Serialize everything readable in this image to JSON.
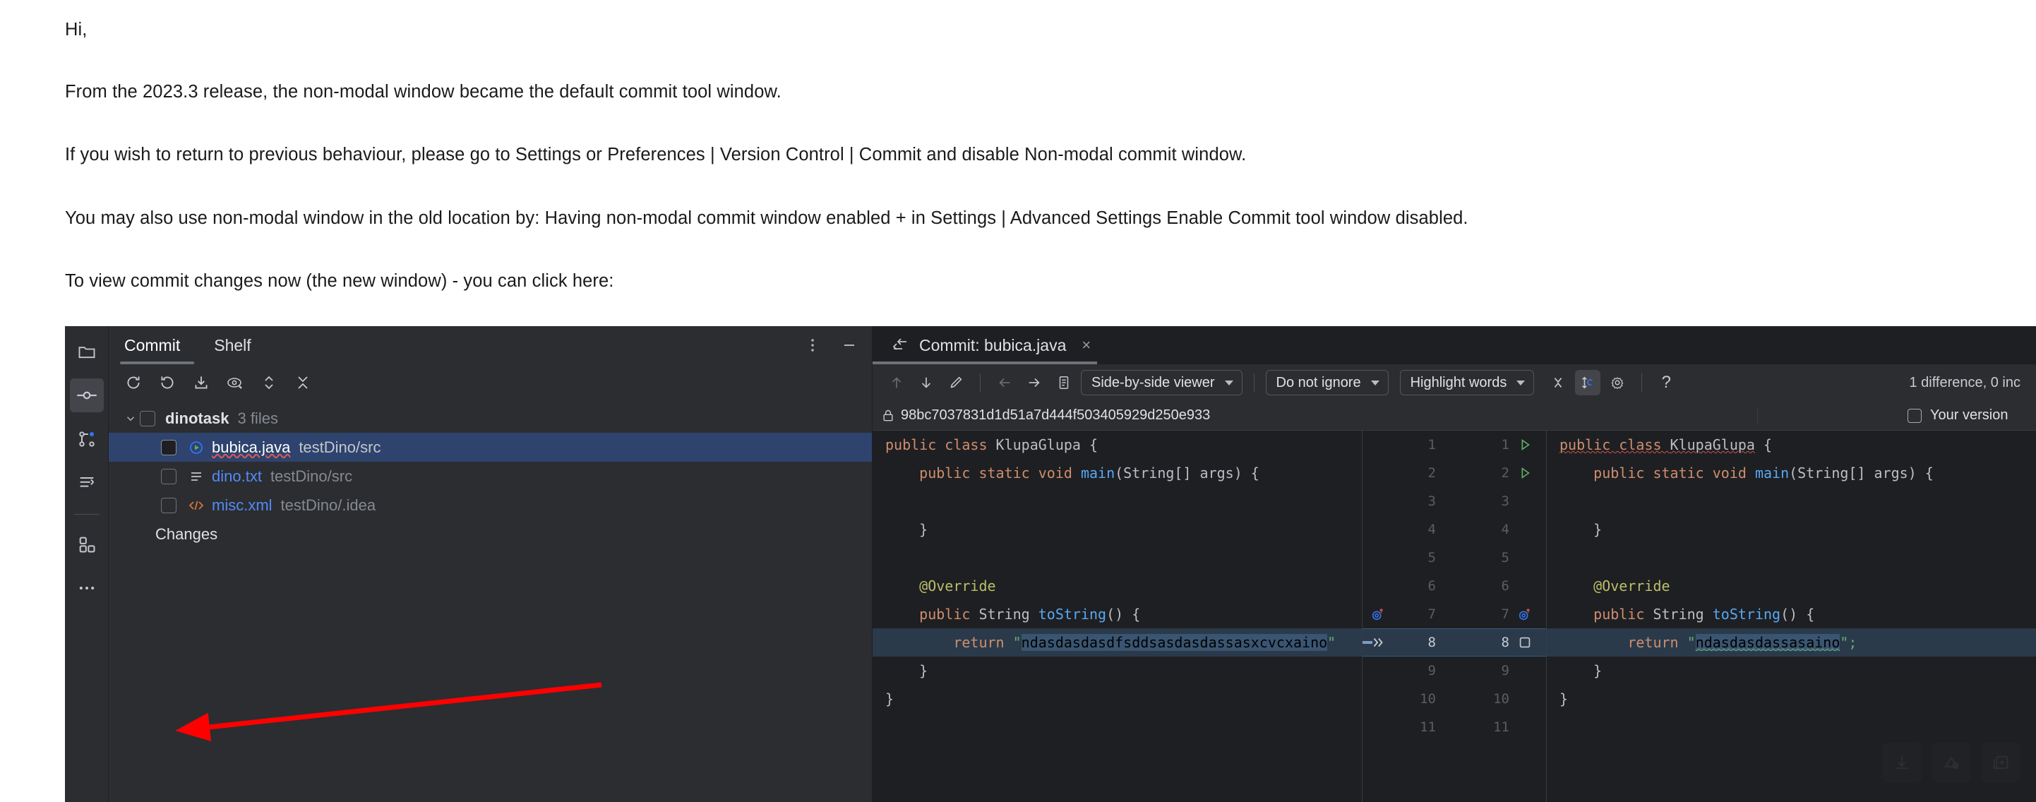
{
  "message": {
    "lines": [
      "Hi,",
      "From the 2023.3 release, the non-modal window became the default commit tool window.",
      "If you wish to return to previous behaviour, please go to Settings or Preferences | Version Control | Commit and disable Non-modal commit window.",
      "You may also use non-modal window in the old location by: Having non-modal commit window enabled + in Settings | Advanced Settings Enable Commit tool window disabled.",
      "To view commit changes now (the new window) - you can click here:"
    ]
  },
  "ide": {
    "activity_bar": {
      "items": [
        {
          "name": "project-icon",
          "label": "Project"
        },
        {
          "name": "commit-icon",
          "label": "Commit",
          "selected": true
        },
        {
          "name": "pull-requests-icon",
          "label": "Pull Requests"
        },
        {
          "name": "terminal-icon",
          "label": "Terminal"
        },
        {
          "name": "services-icon",
          "label": "Services"
        },
        {
          "name": "more-tool-windows-icon",
          "label": "More Tool Windows"
        }
      ]
    },
    "commit_window": {
      "tabs": [
        {
          "label": "Commit",
          "active": true
        },
        {
          "label": "Shelf",
          "active": false
        }
      ],
      "header_actions": [
        {
          "name": "options-menu-icon",
          "label": "Options"
        },
        {
          "name": "hide-icon",
          "label": "Hide"
        }
      ],
      "toolbar": [
        {
          "name": "refresh-icon",
          "label": "Refresh Changes"
        },
        {
          "name": "rollback-icon",
          "label": "Rollback"
        },
        {
          "name": "shelve-icon",
          "label": "Shelve Silently"
        },
        {
          "name": "preview-diff-icon",
          "label": "Preview Diff"
        },
        {
          "name": "expand-collapse-icon",
          "label": "Expand / Collapse"
        },
        {
          "name": "collapse-all-icon",
          "label": "Collapse All"
        }
      ],
      "tree": {
        "root": {
          "name": "dinotask",
          "count": "3 files",
          "expanded": true
        },
        "files": [
          {
            "name": "bubica.java",
            "path": "testDino/src",
            "icon": "java-run-icon",
            "selected": true,
            "checked": false
          },
          {
            "name": "dino.txt",
            "path": "testDino/src",
            "icon": "text-file-icon",
            "selected": false,
            "checked": false
          },
          {
            "name": "misc.xml",
            "path": "testDino/.idea",
            "icon": "xml-file-icon",
            "selected": false,
            "checked": false
          }
        ],
        "changes_label": "Changes"
      }
    },
    "diff": {
      "tab": {
        "title": "Commit: bubica.java",
        "icon": "diff-icon",
        "close": "×"
      },
      "toolbar": {
        "icons": [
          {
            "name": "previous-difference-icon",
            "glyph": "↑",
            "disabled": true
          },
          {
            "name": "next-difference-icon",
            "glyph": "↓",
            "disabled": false
          },
          {
            "name": "edit-source-icon",
            "glyph": "pencil",
            "disabled": false
          },
          {
            "name": "apply-left-icon",
            "glyph": "←",
            "disabled": true
          },
          {
            "name": "apply-right-icon",
            "glyph": "→",
            "disabled": false
          },
          {
            "name": "show-diff-in-editor-icon",
            "glyph": "doc",
            "disabled": false
          }
        ],
        "viewer_mode": "Side-by-side viewer",
        "ignore_mode": "Do not ignore",
        "highlight_mode": "Highlight words",
        "right_icons": [
          {
            "name": "collapse-unchanged-icon",
            "glyph": "×"
          },
          {
            "name": "synchronize-scrolling-icon",
            "glyph": "↕",
            "active": true
          },
          {
            "name": "diff-settings-icon",
            "glyph": "gear"
          },
          {
            "name": "help-icon",
            "glyph": "?"
          }
        ],
        "status": "1 difference, 0 inc"
      },
      "left_header": {
        "icon": "lock-icon",
        "revision": "98bc7037831d1d51a7d444f503405929d250e933"
      },
      "right_header": {
        "checkbox": true,
        "label": "Your version"
      },
      "left_lines": [
        {
          "num": 1,
          "tokens": [
            {
              "t": "public class ",
              "c": "kw"
            },
            {
              "t": "KlupaGlupa",
              "c": "id"
            },
            {
              "t": " {",
              "c": "punc"
            }
          ]
        },
        {
          "num": 2,
          "tokens": [
            {
              "t": "    public static void ",
              "c": "kw"
            },
            {
              "t": "main",
              "c": "fn"
            },
            {
              "t": "(String[] args) {",
              "c": "punc"
            }
          ]
        },
        {
          "num": 3,
          "tokens": [
            {
              "t": "",
              "c": "punc"
            }
          ]
        },
        {
          "num": 4,
          "tokens": [
            {
              "t": "    }",
              "c": "punc"
            }
          ]
        },
        {
          "num": 5,
          "tokens": [
            {
              "t": "",
              "c": "punc"
            }
          ]
        },
        {
          "num": 6,
          "tokens": [
            {
              "t": "    @Override",
              "c": "ann"
            }
          ]
        },
        {
          "num": 7,
          "tokens": [
            {
              "t": "    public ",
              "c": "kw"
            },
            {
              "t": "String ",
              "c": "id"
            },
            {
              "t": "toString",
              "c": "fn"
            },
            {
              "t": "() {",
              "c": "punc"
            }
          ]
        },
        {
          "num": 8,
          "changed": true,
          "tokens": [
            {
              "t": "        return ",
              "c": "kw"
            },
            {
              "t": "\"",
              "c": "str"
            },
            {
              "t": "ndasdasdasdfsddsasdasdassasxcvcxaino",
              "c": "str-hl"
            },
            {
              "t": "\"",
              "c": "str"
            }
          ]
        },
        {
          "num": 9,
          "tokens": [
            {
              "t": "    }",
              "c": "punc"
            }
          ]
        },
        {
          "num": 10,
          "tokens": [
            {
              "t": "}",
              "c": "punc"
            }
          ]
        },
        {
          "num": 11,
          "tokens": [
            {
              "t": "",
              "c": "punc"
            }
          ]
        }
      ],
      "right_lines": [
        {
          "num": 1,
          "tokens": [
            {
              "t": "public class ",
              "c": "kw wavy-red"
            },
            {
              "t": "KlupaGlupa",
              "c": "id wavy-red"
            },
            {
              "t": " {",
              "c": "punc"
            }
          ]
        },
        {
          "num": 2,
          "tokens": [
            {
              "t": "    public static void ",
              "c": "kw"
            },
            {
              "t": "main",
              "c": "fn"
            },
            {
              "t": "(String[] args) {",
              "c": "punc"
            }
          ]
        },
        {
          "num": 3,
          "tokens": [
            {
              "t": "",
              "c": "punc"
            }
          ]
        },
        {
          "num": 4,
          "tokens": [
            {
              "t": "    }",
              "c": "punc"
            }
          ]
        },
        {
          "num": 5,
          "tokens": [
            {
              "t": "",
              "c": "punc"
            }
          ]
        },
        {
          "num": 6,
          "tokens": [
            {
              "t": "    @Override",
              "c": "ann"
            }
          ]
        },
        {
          "num": 7,
          "tokens": [
            {
              "t": "    public ",
              "c": "kw"
            },
            {
              "t": "String ",
              "c": "id"
            },
            {
              "t": "toString",
              "c": "fn"
            },
            {
              "t": "() {",
              "c": "punc"
            }
          ]
        },
        {
          "num": 8,
          "changed": true,
          "tokens": [
            {
              "t": "        return ",
              "c": "kw"
            },
            {
              "t": "\"",
              "c": "str"
            },
            {
              "t": "ndasdasdassasaino",
              "c": "str-hl wavy-green"
            },
            {
              "t": "\";",
              "c": "str"
            }
          ]
        },
        {
          "num": 9,
          "tokens": [
            {
              "t": "    }",
              "c": "punc"
            }
          ]
        },
        {
          "num": 10,
          "tokens": [
            {
              "t": "}",
              "c": "punc"
            }
          ]
        },
        {
          "num": 11,
          "tokens": [
            {
              "t": "",
              "c": "punc"
            }
          ]
        }
      ],
      "gutter": [
        {
          "l": 1,
          "r": 1,
          "left_icon": "",
          "right_icon": "run-icon"
        },
        {
          "l": 2,
          "r": 2,
          "left_icon": "",
          "right_icon": "run-icon"
        },
        {
          "l": 3,
          "r": 3,
          "left_icon": "",
          "right_icon": ""
        },
        {
          "l": 4,
          "r": 4,
          "left_icon": "",
          "right_icon": ""
        },
        {
          "l": 5,
          "r": 5,
          "left_icon": "",
          "right_icon": ""
        },
        {
          "l": 6,
          "r": 6,
          "left_icon": "",
          "right_icon": ""
        },
        {
          "l": 7,
          "r": 7,
          "left_icon": "override-icon",
          "right_icon": "override-icon"
        },
        {
          "l": 8,
          "r": 8,
          "changed": true,
          "left_icon": "apply-change-icon",
          "right_icon": "revert-checkbox-icon"
        },
        {
          "l": 9,
          "r": 9,
          "left_icon": "",
          "right_icon": ""
        },
        {
          "l": 10,
          "r": 10,
          "left_icon": "",
          "right_icon": ""
        },
        {
          "l": 11,
          "r": 11,
          "left_icon": "",
          "right_icon": ""
        }
      ],
      "overlay_actions": [
        {
          "name": "download-image-icon"
        },
        {
          "name": "open-in-lens-icon"
        },
        {
          "name": "add-to-collection-icon"
        }
      ]
    }
  },
  "annotation": {
    "arrow_color": "#ff0000",
    "name": "red-arrow-annotation"
  }
}
